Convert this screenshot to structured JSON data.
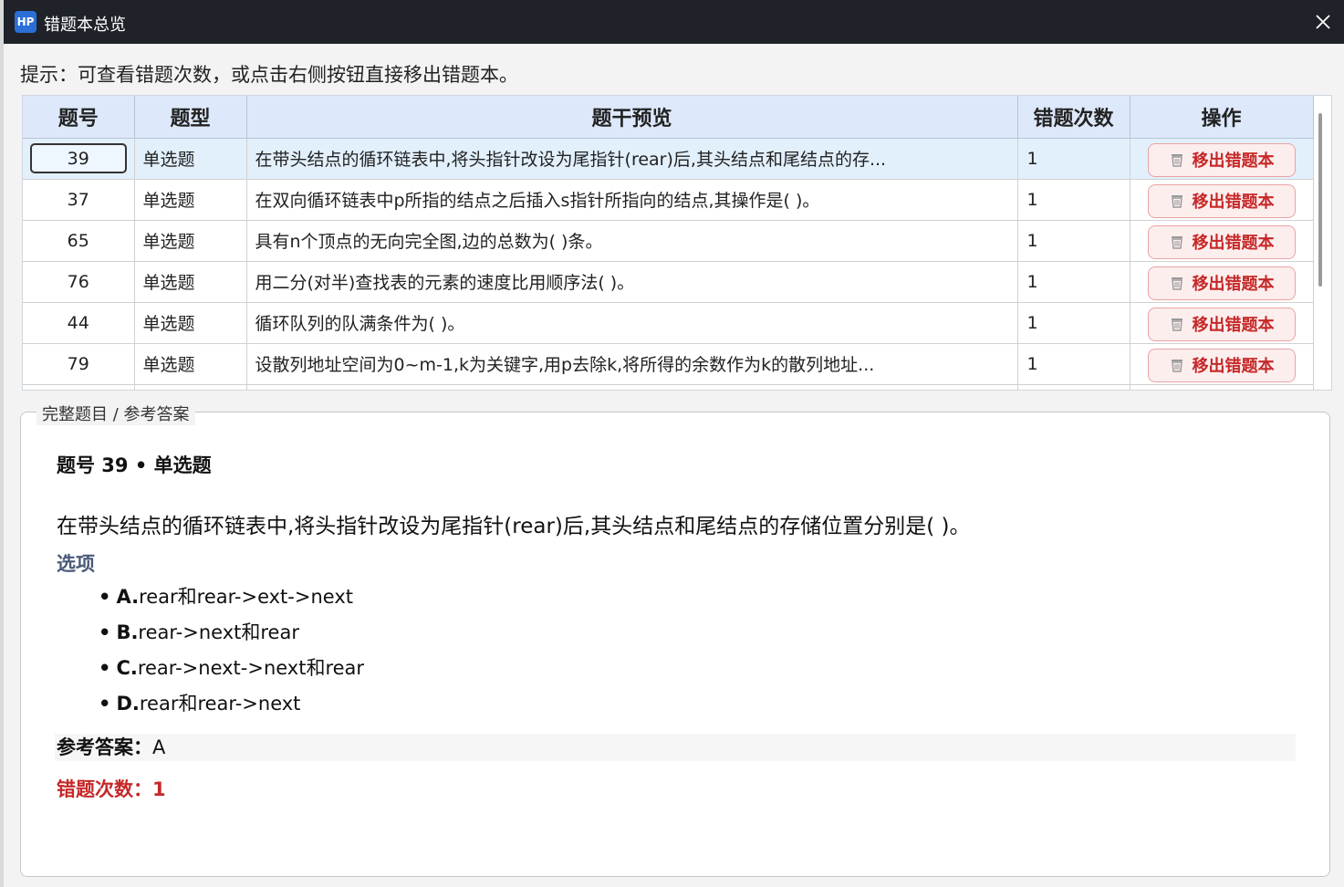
{
  "window": {
    "icon_text": "HP",
    "title": "错题本总览"
  },
  "hint": "提示：可查看错题次数，或点击右侧按钮直接移出错题本。",
  "table": {
    "headers": [
      "题号",
      "题型",
      "题干预览",
      "错题次数",
      "操作"
    ],
    "remove_label": "移出错题本",
    "rows": [
      {
        "id": "39",
        "type": "单选题",
        "stem": "在带头结点的循环链表中,将头指针改设为尾指针(rear)后,其头结点和尾结点的存...",
        "count": "1"
      },
      {
        "id": "37",
        "type": "单选题",
        "stem": "在双向循环链表中p所指的结点之后插入s指针所指向的结点,其操作是( )。",
        "count": "1"
      },
      {
        "id": "65",
        "type": "单选题",
        "stem": "具有n个顶点的无向完全图,边的总数为( )条。",
        "count": "1"
      },
      {
        "id": "76",
        "type": "单选题",
        "stem": "用二分(对半)查找表的元素的速度比用顺序法( )。",
        "count": "1"
      },
      {
        "id": "44",
        "type": "单选题",
        "stem": "循环队列的队满条件为( )。",
        "count": "1"
      },
      {
        "id": "79",
        "type": "单选题",
        "stem": "设散列地址空间为0~m-1,k为关键字,用p去除k,将所得的余数作为k的散列地址...",
        "count": "1"
      }
    ]
  },
  "detail": {
    "legend": "完整题目 / 参考答案",
    "heading": "题号 39 • 单选题",
    "question": "在带头结点的循环链表中,将头指针改设为尾指针(rear)后,其头结点和尾结点的存储位置分别是( )。",
    "options_label": "选项",
    "options": [
      {
        "letter": "A.",
        "text": "rear和rear->ext->next"
      },
      {
        "letter": "B.",
        "text": "rear->next和rear"
      },
      {
        "letter": "C.",
        "text": "rear->next->next和rear"
      },
      {
        "letter": "D.",
        "text": "rear和rear->next"
      }
    ],
    "answer_key": "参考答案：",
    "answer_value": "A",
    "wrong_count_text": "错题次数：1"
  }
}
